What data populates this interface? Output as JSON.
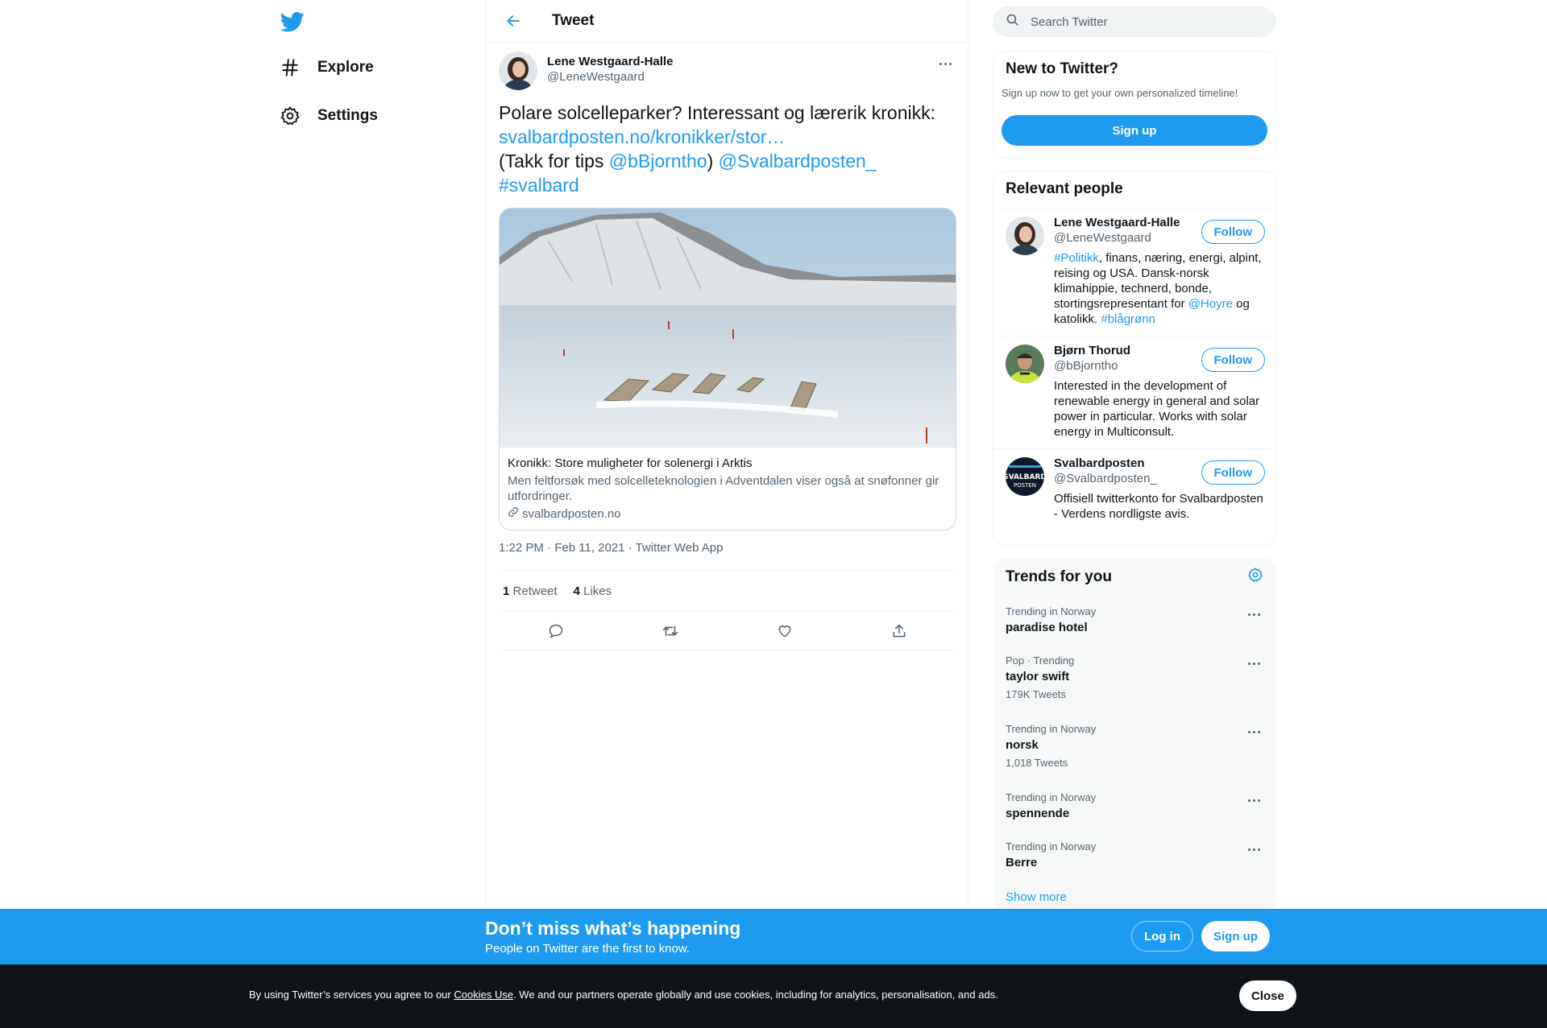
{
  "nav": {
    "items": [
      {
        "label": "Explore",
        "icon": "hashtag-icon"
      },
      {
        "label": "Settings",
        "icon": "gear-icon"
      }
    ]
  },
  "header": {
    "title": "Tweet"
  },
  "tweet": {
    "author_name": "Lene Westgaard-Halle",
    "author_handle": "@LeneWestgaard",
    "text_line1": "Polare solcelleparker? Interessant og lærerik kronikk:",
    "link": "svalbardposten.no/kronikker/stor…",
    "text_line3_prefix": "(Takk for tips ",
    "mention1": "@bBjorntho",
    "text_line3_mid": ")",
    "mention2": "@Svalbardposten_",
    "hashtag": "#svalbard",
    "card": {
      "title": "Kronikk: Store muligheter for solenergi i Arktis",
      "description": "Men feltforsøk med solcelleteknologien i Adventdalen viser også at snøfonner gir utfordringer.",
      "domain": "svalbardposten.no"
    },
    "timestamp": "1:22 PM · Feb 11, 2021 · Twitter Web App",
    "retweets_count": "1",
    "retweets_label": "Retweet",
    "likes_count": "4",
    "likes_label": "Likes"
  },
  "search": {
    "placeholder": "Search Twitter"
  },
  "new_to_twitter": {
    "title": "New to Twitter?",
    "subtitle": "Sign up now to get your own personalized timeline!",
    "button": "Sign up"
  },
  "relevant_people": {
    "title": "Relevant people",
    "follow_label": "Follow",
    "people": [
      {
        "name": "Lene Westgaard-Halle",
        "handle": "@LeneWestgaard",
        "bio_tag": "#Politikk",
        "bio_a": ", finans, næring, energi, alpint, reising og USA. Dansk-norsk klimahippie, technerd, bonde, stortingsrepresentant for ",
        "bio_mention": "@Hoyre",
        "bio_b": " og katolikk. ",
        "bio_tag2": "#blågrønn"
      },
      {
        "name": "Bjørn Thorud",
        "handle": "@bBjorntho",
        "bio": "Interested in the development of renewable energy in general and solar power in particular. Works with solar energy in Multiconsult."
      },
      {
        "name": "Svalbardposten",
        "handle": "@Svalbardposten_",
        "bio": "Offisiell twitterkonto for Svalbardposten - Verdens nordligste avis.",
        "logo_text": "SVALBARD POSTEN"
      }
    ]
  },
  "trends": {
    "title": "Trends for you",
    "items": [
      {
        "context": "Trending in Norway",
        "name": "paradise hotel",
        "count": ""
      },
      {
        "context": "Pop · Trending",
        "name": "taylor swift",
        "count": "179K Tweets"
      },
      {
        "context": "Trending in Norway",
        "name": "norsk",
        "count": "1,018 Tweets"
      },
      {
        "context": "Trending in Norway",
        "name": "spennende",
        "count": ""
      },
      {
        "context": "Trending in Norway",
        "name": "Berre",
        "count": ""
      }
    ],
    "show_more": "Show more"
  },
  "banner": {
    "title": "Don’t miss what’s happening",
    "subtitle": "People on Twitter are the first to know.",
    "login": "Log in",
    "signup": "Sign up"
  },
  "cookie": {
    "text_before": "By using Twitter’s services you agree to our ",
    "link": "Cookies Use",
    "text_after": ". We and our partners operate globally and use cookies, including for analytics, personalisation, and ads.",
    "close": "Close"
  },
  "colors": {
    "accent": "#1d9bf0",
    "text": "#0f1419",
    "muted": "#536471",
    "cookie_bg": "#0f1419"
  }
}
